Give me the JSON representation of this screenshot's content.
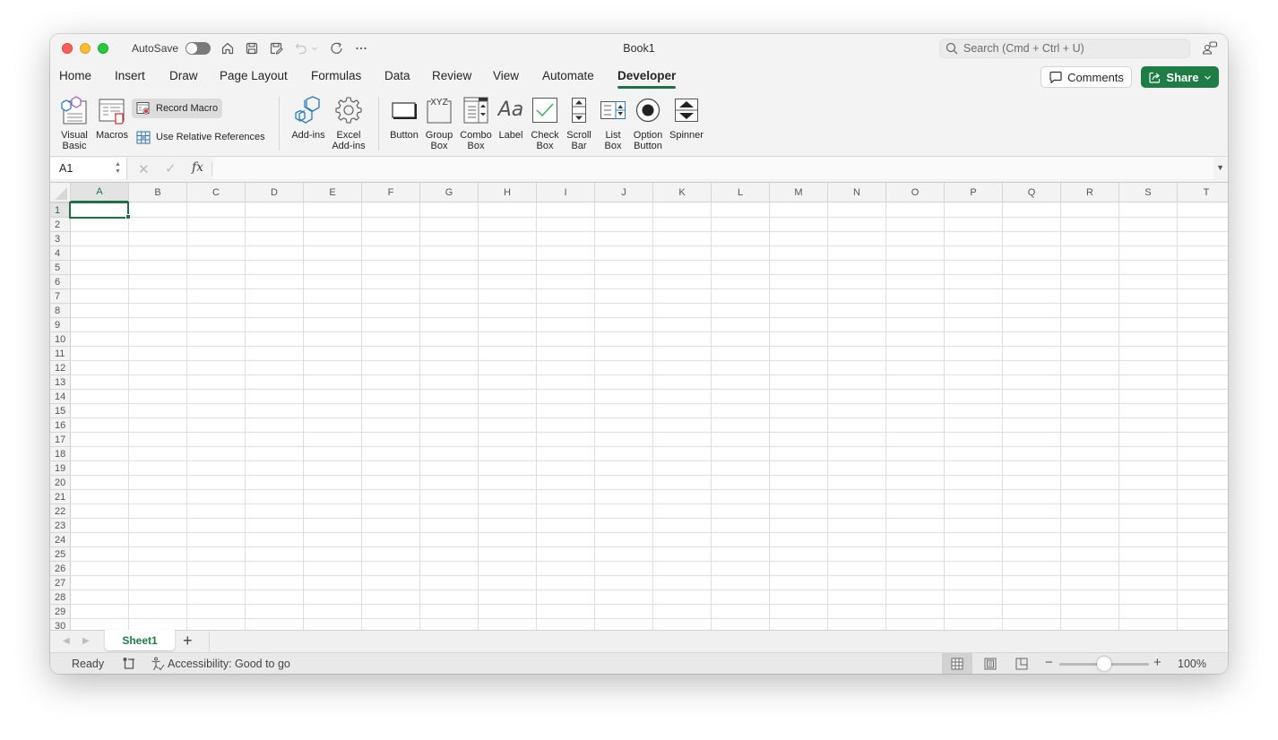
{
  "window": {
    "title": "Book1",
    "autosave_label": "AutoSave",
    "autosave_on": false,
    "search_placeholder": "Search (Cmd + Ctrl + U)"
  },
  "quick_access": [
    {
      "name": "home-icon"
    },
    {
      "name": "save-icon"
    },
    {
      "name": "save-as-icon"
    },
    {
      "name": "undo-icon"
    },
    {
      "name": "undo-dropdown-icon"
    },
    {
      "name": "redo-icon"
    },
    {
      "name": "more-icon"
    }
  ],
  "tabs": [
    {
      "label": "Home",
      "active": false
    },
    {
      "label": "Insert",
      "active": false
    },
    {
      "label": "Draw",
      "active": false
    },
    {
      "label": "Page Layout",
      "active": false
    },
    {
      "label": "Formulas",
      "active": false
    },
    {
      "label": "Data",
      "active": false
    },
    {
      "label": "Review",
      "active": false
    },
    {
      "label": "View",
      "active": false
    },
    {
      "label": "Automate",
      "active": false
    },
    {
      "label": "Developer",
      "active": true
    }
  ],
  "header_buttons": {
    "comments": "Comments",
    "share": "Share"
  },
  "ribbon": {
    "visual_basic": "Visual\nBasic",
    "visual_basic_l1": "Visual",
    "visual_basic_l2": "Basic",
    "macros": "Macros",
    "record_macro": "Record Macro",
    "use_relative_references": "Use Relative References",
    "add_ins": "Add-ins",
    "excel_add_ins_l1": "Excel",
    "excel_add_ins_l2": "Add-ins",
    "controls": [
      {
        "l1": "Button",
        "l2": ""
      },
      {
        "l1": "Group",
        "l2": "Box"
      },
      {
        "l1": "Combo",
        "l2": "Box"
      },
      {
        "l1": "Label",
        "l2": ""
      },
      {
        "l1": "Check",
        "l2": "Box"
      },
      {
        "l1": "Scroll",
        "l2": "Bar"
      },
      {
        "l1": "List",
        "l2": "Box"
      },
      {
        "l1": "Option",
        "l2": "Button"
      },
      {
        "l1": "Spinner",
        "l2": ""
      }
    ],
    "group_box_glyph": "XYZ",
    "label_glyph": "Aa"
  },
  "formula_bar": {
    "name_box": "A1",
    "fx": "fx",
    "cancel_glyph": "✕",
    "enter_glyph": "✓",
    "value": ""
  },
  "grid": {
    "columns": [
      "A",
      "B",
      "C",
      "D",
      "E",
      "F",
      "G",
      "H",
      "I",
      "J",
      "K",
      "L",
      "M",
      "N",
      "O",
      "P",
      "Q",
      "R",
      "S",
      "T"
    ],
    "rows": [
      "1",
      "2",
      "3",
      "4",
      "5",
      "6",
      "7",
      "8",
      "9",
      "10",
      "11",
      "12",
      "13",
      "14",
      "15",
      "16",
      "17",
      "18",
      "19",
      "20",
      "21",
      "22",
      "23",
      "24",
      "25",
      "26",
      "27",
      "28",
      "29",
      "30"
    ],
    "active_cell": "A1",
    "active_col": "A",
    "active_row": "1"
  },
  "sheets": [
    {
      "label": "Sheet1",
      "active": true
    }
  ],
  "add_sheet": "+",
  "status": {
    "ready": "Ready",
    "accessibility": "Accessibility: Good to go",
    "zoom_minus": "−",
    "zoom_plus": "+",
    "zoom_level": "100%",
    "zoom_percent": 100,
    "active_view": "normal"
  },
  "colors": {
    "accent": "#1e7145",
    "share_button": "#1e7c45"
  }
}
